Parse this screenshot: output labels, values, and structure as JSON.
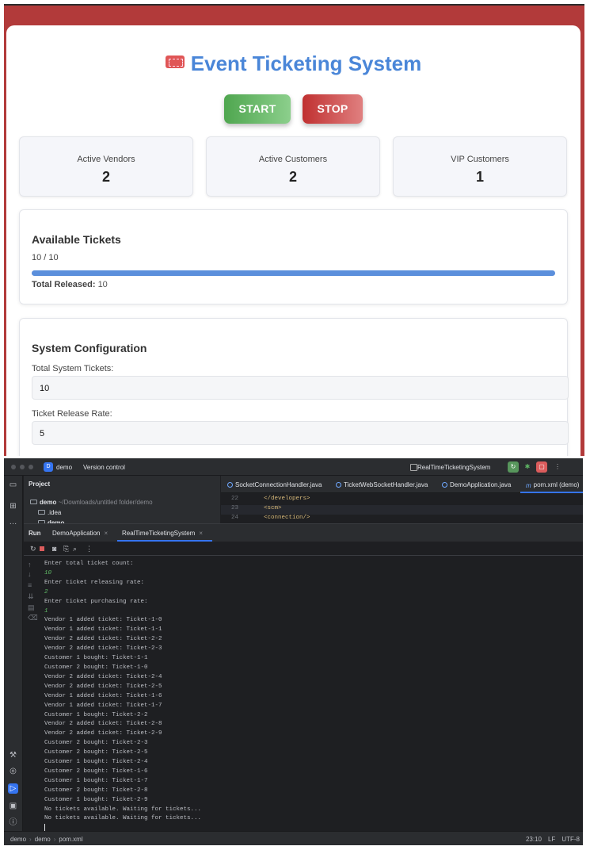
{
  "web": {
    "title": "Event Ticketing System",
    "start_label": "START",
    "stop_label": "STOP",
    "stats": [
      {
        "label": "Active Vendors",
        "value": "2"
      },
      {
        "label": "Active Customers",
        "value": "2"
      },
      {
        "label": "VIP Customers",
        "value": "1"
      }
    ],
    "tickets": {
      "heading": "Available Tickets",
      "count_text": "10 / 10",
      "progress_fraction": 1.0,
      "total_released_label": "Total Released:",
      "total_released_value": "10"
    },
    "config": {
      "heading": "System Configuration",
      "fields": [
        {
          "label": "Total System Tickets:",
          "value": "10"
        },
        {
          "label": "Ticket Release Rate:",
          "value": "5"
        }
      ]
    },
    "colors": {
      "accent": "#4a86d8",
      "header_bg": "#b23a3a",
      "start": "#4fa64f",
      "stop": "#c03030"
    }
  },
  "ide": {
    "project_badge": "D",
    "project_name": "demo",
    "version_control": "Version control",
    "run_config": "RealTimeTicketingSystem",
    "project_panel": {
      "header": "Project",
      "tree": [
        {
          "name": "demo",
          "path": "~/Downloads/untitled folder/demo"
        },
        {
          "name": ".idea"
        },
        {
          "name": "demo"
        }
      ]
    },
    "editor_tabs": [
      "SocketConnectionHandler.java",
      "TicketWebSocketHandler.java",
      "DemoApplication.java",
      "pom.xml (demo)"
    ],
    "editor_lines": [
      {
        "num": "22",
        "text": "</developers>"
      },
      {
        "num": "23",
        "text": "<scm>"
      },
      {
        "num": "24",
        "text": "    <connection/>"
      }
    ],
    "run_panel": {
      "label": "Run",
      "tabs": [
        "DemoApplication",
        "RealTimeTicketingSystem"
      ]
    },
    "console_lines": [
      {
        "text": "Enter total ticket count:",
        "input": false
      },
      {
        "text": "10",
        "input": true
      },
      {
        "text": "Enter ticket releasing rate:",
        "input": false
      },
      {
        "text": "2",
        "input": true
      },
      {
        "text": "Enter ticket purchasing rate:",
        "input": false
      },
      {
        "text": "1",
        "input": true
      },
      {
        "text": "Vendor 1 added ticket: Ticket-1-0",
        "input": false
      },
      {
        "text": "Vendor 1 added ticket: Ticket-1-1",
        "input": false
      },
      {
        "text": "Vendor 2 added ticket: Ticket-2-2",
        "input": false
      },
      {
        "text": "Vendor 2 added ticket: Ticket-2-3",
        "input": false
      },
      {
        "text": "Customer 1 bought: Ticket-1-1",
        "input": false
      },
      {
        "text": "Customer 2 bought: Ticket-1-0",
        "input": false
      },
      {
        "text": "Vendor 2 added ticket: Ticket-2-4",
        "input": false
      },
      {
        "text": "Vendor 2 added ticket: Ticket-2-5",
        "input": false
      },
      {
        "text": "Vendor 1 added ticket: Ticket-1-6",
        "input": false
      },
      {
        "text": "Vendor 1 added ticket: Ticket-1-7",
        "input": false
      },
      {
        "text": "Customer 1 bought: Ticket-2-2",
        "input": false
      },
      {
        "text": "Vendor 2 added ticket: Ticket-2-8",
        "input": false
      },
      {
        "text": "Vendor 2 added ticket: Ticket-2-9",
        "input": false
      },
      {
        "text": "Customer 2 bought: Ticket-2-3",
        "input": false
      },
      {
        "text": "Customer 2 bought: Ticket-2-5",
        "input": false
      },
      {
        "text": "Customer 1 bought: Ticket-2-4",
        "input": false
      },
      {
        "text": "Customer 2 bought: Ticket-1-6",
        "input": false
      },
      {
        "text": "Customer 1 bought: Ticket-1-7",
        "input": false
      },
      {
        "text": "Customer 2 bought: Ticket-2-8",
        "input": false
      },
      {
        "text": "Customer 1 bought: Ticket-2-9",
        "input": false
      },
      {
        "text": "No tickets available. Waiting for tickets...",
        "input": false
      },
      {
        "text": "No tickets available. Waiting for tickets...",
        "input": false
      }
    ],
    "status_bar": {
      "breadcrumb": [
        "demo",
        "demo",
        "pom.xml"
      ],
      "position": "23:10",
      "line_sep": "LF",
      "encoding": "UTF-8"
    }
  }
}
